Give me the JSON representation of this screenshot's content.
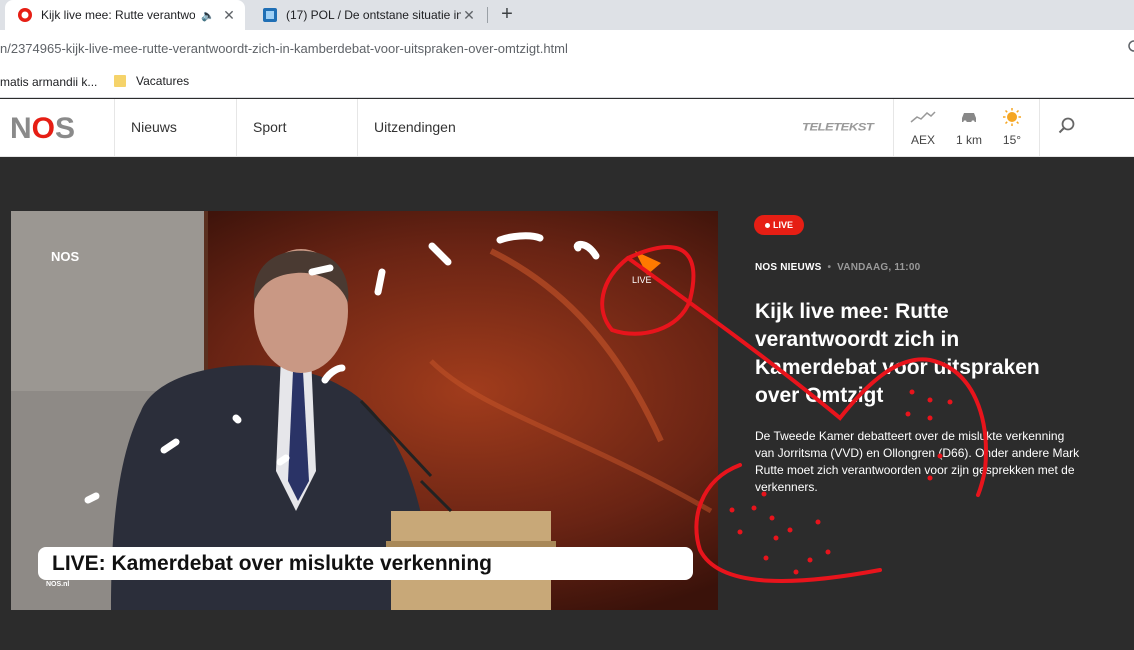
{
  "browser": {
    "tabs": [
      {
        "title": "Kijk live mee: Rutte verantwoo",
        "active": true
      },
      {
        "title": "(17) POL / De ontstane situatie in",
        "active": false
      }
    ],
    "new_tab": "+",
    "close": "✕",
    "url": "n/2374965-kijk-live-mee-rutte-verantwoordt-zich-in-kamberdebat-voor-uitspraken-over-omtzigt.html",
    "bookmarks": [
      {
        "label": "matis armandii k..."
      },
      {
        "label": "Vacatures",
        "icon": "folder-icon"
      }
    ]
  },
  "site": {
    "logo_prefix": "N",
    "logo_o": "O",
    "logo_suffix": "S",
    "nav": [
      "Nieuws",
      "Sport",
      "Uitzendingen"
    ],
    "teletekst": "TELETEKST",
    "widgets": [
      {
        "icon": "chart-icon",
        "label": "AEX"
      },
      {
        "icon": "car-icon",
        "label": "1 km"
      },
      {
        "icon": "sun-icon",
        "label": "15°"
      }
    ],
    "accent": "#e61e14"
  },
  "article": {
    "live_badge": "LIVE",
    "source": "NOS NIEUWS",
    "date": "VANDAAG, 11:00",
    "headline": "Kijk live mee: Rutte verantwoordt zich in Kamerdebat voor uitspraken over Omtzigt",
    "summary": "De Tweede Kamer debatteert over de mislukte verkenning van Jorritsma (VVD) en Ollongren (D66). Onder andere Mark Rutte moet zich verantwoorden voor zijn gesprekken met de verkenners.",
    "video": {
      "watermark": "NOS",
      "corner_label": "LIVE",
      "caption": "LIVE: Kamerdebat over mislukte verkenning",
      "tiny_logo": "NOS.nl"
    }
  }
}
